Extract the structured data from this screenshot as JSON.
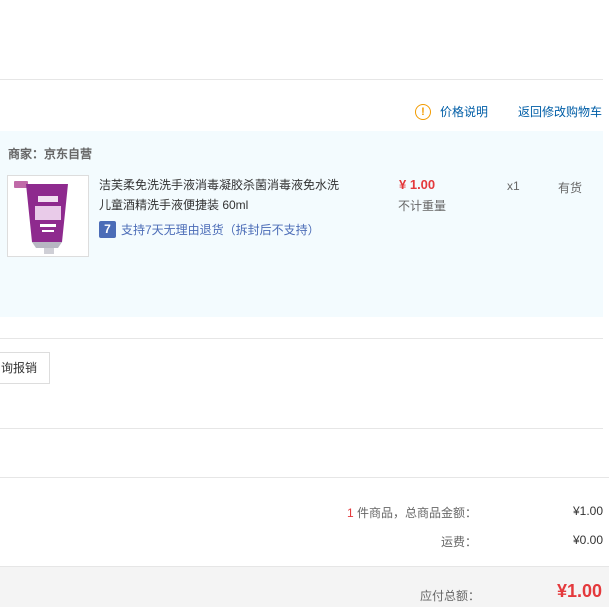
{
  "header": {
    "price_note_icon": "exclamation-circle-icon",
    "price_note": "价格说明",
    "back_link": "返回修改购物车"
  },
  "order": {
    "merchant": "商家：京东自营",
    "product": {
      "title": "洁芙柔免洗洗手液消毒凝胶杀菌消毒液免水洗儿童酒精洗手液便捷装 60ml",
      "service_icon_glyph": "7",
      "service": "支持7天无理由退货（拆封后不支持）",
      "price": "¥ 1.00",
      "weight": "不计重量",
      "qty": "x1",
      "stock": "有货"
    }
  },
  "invoice": {
    "button": "询报销"
  },
  "summary": {
    "count": "1",
    "count_suffix": " 件商品，总商品金额：",
    "goods_total": "¥1.00",
    "shipping_label": "运费：",
    "shipping": "¥0.00",
    "payable_label": "应付总额：",
    "payable": "¥1.00"
  },
  "colors": {
    "accent_red": "#e4393c",
    "link_blue": "#005ea7",
    "warn_orange": "#f29b00",
    "box_bg": "#f3fbfe"
  }
}
